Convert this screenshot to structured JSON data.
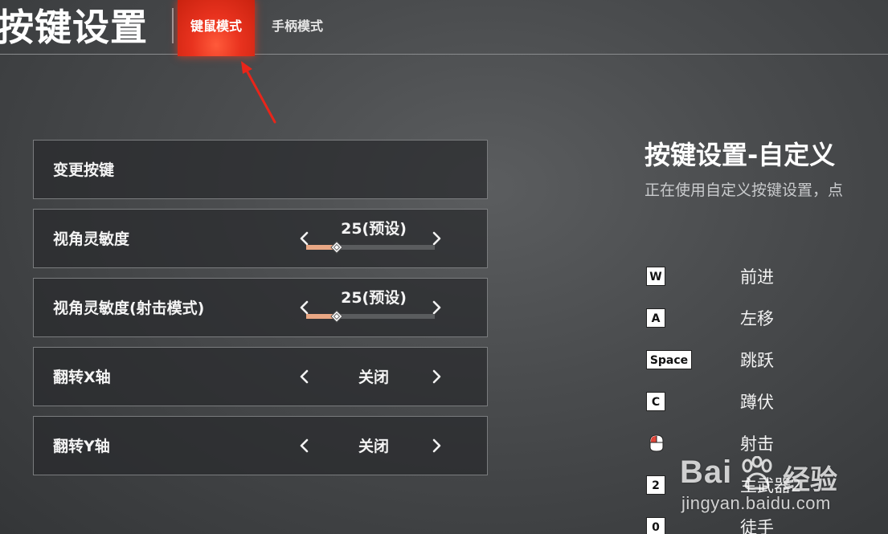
{
  "header": {
    "title": "按键设置",
    "tabs": [
      {
        "label": "键鼠模式",
        "active": true
      },
      {
        "label": "手柄模式",
        "active": false
      }
    ]
  },
  "settings": {
    "change_keys": "变更按键",
    "rows": [
      {
        "label": "视角灵敏度",
        "value": "25(预设)",
        "slider_fraction": 0.24
      },
      {
        "label": "视角灵敏度(射击模式)",
        "value": "25(预设)",
        "slider_fraction": 0.24
      },
      {
        "label": "翻转X轴",
        "value": "关闭"
      },
      {
        "label": "翻转Y轴",
        "value": "关闭"
      }
    ]
  },
  "right_panel": {
    "title": "按键设置-自定义",
    "description": "正在使用自定义按键设置，点"
  },
  "keymap": [
    {
      "key": "W",
      "action": "前进"
    },
    {
      "key": "A",
      "action": "左移"
    },
    {
      "key": "Space",
      "action": "跳跃"
    },
    {
      "key": "C",
      "action": "蹲伏"
    },
    {
      "key": "mouse-left-icon",
      "action": "射击"
    },
    {
      "key": "2",
      "action": "主武器2"
    },
    {
      "key": "0",
      "action": "徒手"
    }
  ],
  "watermark": {
    "brand": "Bai",
    "brand_cn": "经验",
    "url": "jingyan.baidu.com"
  },
  "colors": {
    "active_tab": "#e8321e",
    "slider_fill": "#e9a784",
    "annotation_arrow": "#e8251a"
  }
}
